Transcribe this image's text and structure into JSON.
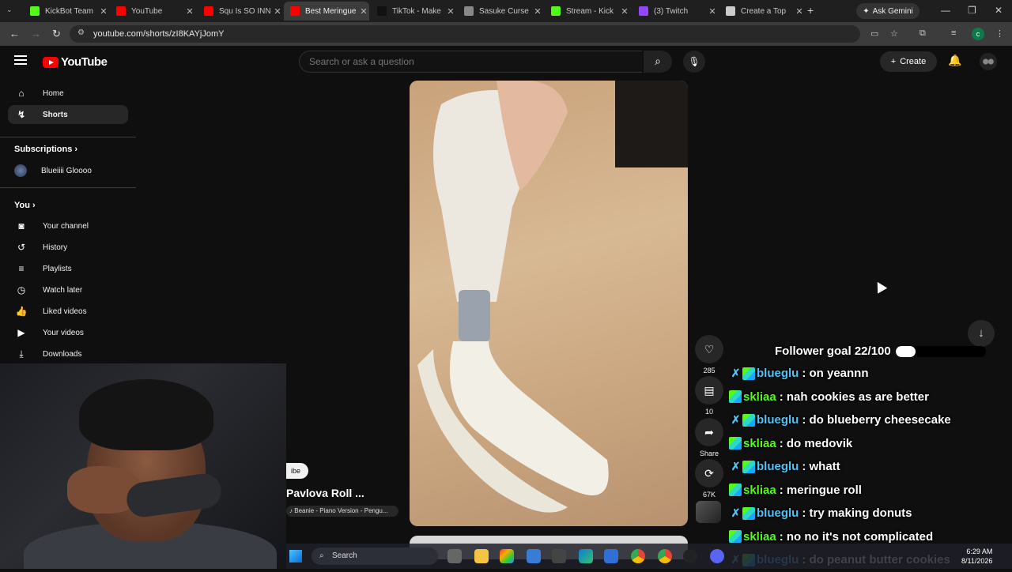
{
  "browser": {
    "tabs": [
      {
        "title": "KickBot Team",
        "icon_color": "#53fc18"
      },
      {
        "title": "YouTube",
        "icon_color": "#ff0000"
      },
      {
        "title": "Squ Is SO INN",
        "icon_color": "#ff0000"
      },
      {
        "title": "Best Meringue",
        "icon_color": "#ff0000"
      },
      {
        "title": "TikTok - Make",
        "icon_color": "#111111"
      },
      {
        "title": "Sasuke Curse",
        "icon_color": "#888888"
      },
      {
        "title": "Stream - Kick",
        "icon_color": "#53fc18"
      },
      {
        "title": "(3) Twitch",
        "icon_color": "#9146ff"
      },
      {
        "title": "Create a Top",
        "icon_color": "#cccccc"
      }
    ],
    "active_tab_index": 3,
    "new_tab_label": "+",
    "gemini_label": "Ask Gemini",
    "url": "youtube.com/shorts/zI8KAYjJomY",
    "profile_initial": "c"
  },
  "youtube": {
    "logo_text": "YouTube",
    "search_placeholder": "Search or ask a question",
    "create_label": "Create",
    "sidebar": {
      "main_items": [
        {
          "label": "Home",
          "icon": "home-icon",
          "glyph": "⌂"
        },
        {
          "label": "Shorts",
          "icon": "shorts-icon",
          "glyph": "↯"
        }
      ],
      "subscriptions_heading": "Subscriptions",
      "subscriptions": [
        {
          "label": "Blueiiii Gloooo"
        }
      ],
      "you_heading": "You",
      "you_items": [
        {
          "label": "Your channel",
          "icon": "person-icon",
          "glyph": "◙"
        },
        {
          "label": "History",
          "icon": "history-icon",
          "glyph": "↺"
        },
        {
          "label": "Playlists",
          "icon": "playlist-icon",
          "glyph": "≡"
        },
        {
          "label": "Watch later",
          "icon": "clock-icon",
          "glyph": "◷"
        },
        {
          "label": "Liked videos",
          "icon": "thumbs-up-icon",
          "glyph": "👍"
        },
        {
          "label": "Your videos",
          "icon": "video-icon",
          "glyph": "▶"
        },
        {
          "label": "Downloads",
          "icon": "download-icon",
          "glyph": "⤓"
        }
      ]
    },
    "short": {
      "title": "Pavlova Roll ...",
      "subscribe_label": "ibe",
      "music": "Beanie - Piano Version - Pengu..."
    },
    "actions": [
      {
        "name": "like",
        "icon": "heart-icon",
        "glyph": "♡",
        "label": "285"
      },
      {
        "name": "comments",
        "icon": "comment-icon",
        "glyph": "▤",
        "label": "10"
      },
      {
        "name": "share",
        "icon": "share-icon",
        "glyph": "➦",
        "label": "Share"
      },
      {
        "name": "remix",
        "icon": "remix-icon",
        "glyph": "⟳",
        "label": "67K"
      }
    ]
  },
  "overlay": {
    "follower_goal_text": "Follower goal 22/100",
    "follower_goal_progress": 0.22,
    "chat": [
      {
        "user": "blueglu",
        "text": "on yeannn",
        "color": "#4fc3f7",
        "sword": true
      },
      {
        "user": "skliaa",
        "text": "nah cookies as are better",
        "color": "#53fc18",
        "sword": false
      },
      {
        "user": "blueglu",
        "text": "do blueberry cheesecake",
        "color": "#4fc3f7",
        "sword": true
      },
      {
        "user": "skliaa",
        "text": "do medovik",
        "color": "#53fc18",
        "sword": false
      },
      {
        "user": "blueglu",
        "text": "whatt",
        "color": "#4fc3f7",
        "sword": true
      },
      {
        "user": "skliaa",
        "text": "meringue roll",
        "color": "#53fc18",
        "sword": false
      },
      {
        "user": "blueglu",
        "text": "try making donuts",
        "color": "#4fc3f7",
        "sword": true
      },
      {
        "user": "skliaa",
        "text": "no no it's not complicated",
        "color": "#53fc18",
        "sword": false
      },
      {
        "user": "blueglu",
        "text": "do peanut butter cookies",
        "color": "#4fc3f7",
        "sword": true
      }
    ]
  },
  "taskbar": {
    "search_label": "Search",
    "time": "6:29 AM",
    "date": "8/11/2026"
  }
}
